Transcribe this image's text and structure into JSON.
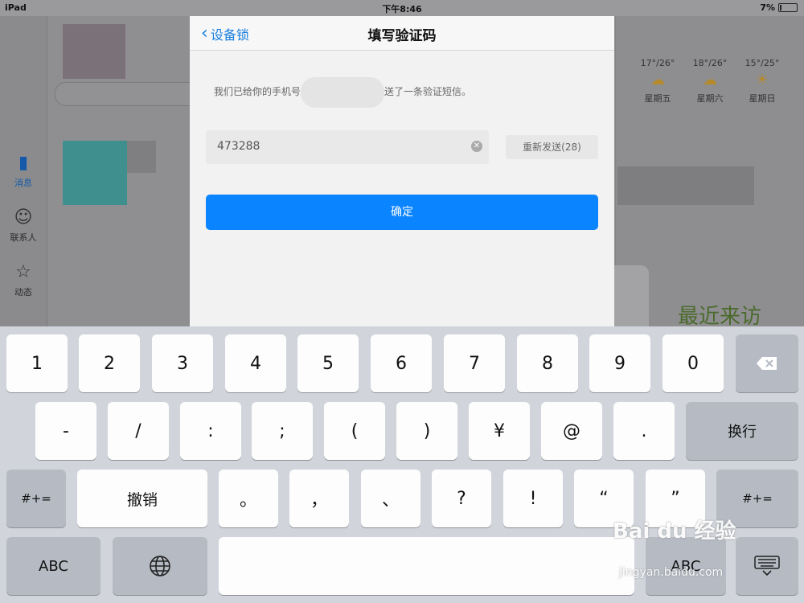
{
  "statusbar": {
    "device": "iPad",
    "time": "下午8:46",
    "battery": "7%"
  },
  "sidebar": {
    "items": [
      {
        "label": "消息",
        "icon": "message-icon"
      },
      {
        "label": "联系人",
        "icon": "contacts-icon"
      },
      {
        "label": "动态",
        "icon": "star-icon"
      }
    ]
  },
  "weather": [
    {
      "temp": "17°/26°",
      "day": "星期五"
    },
    {
      "temp": "18°/26°",
      "day": "星期六"
    },
    {
      "temp": "15°/25°",
      "day": "星期日"
    }
  ],
  "recent_visitors": "最近来访",
  "modal": {
    "back_label": "设备锁",
    "title": "填写验证码",
    "hint_prefix": "我们已给你的手机号",
    "hint_suffix": "送了一条验证短信。",
    "code_value": "473288",
    "resend_label": "重新发送(28)",
    "confirm_label": "确定"
  },
  "keyboard": {
    "row1": [
      "1",
      "2",
      "3",
      "4",
      "5",
      "6",
      "7",
      "8",
      "9",
      "0"
    ],
    "row2": [
      "-",
      "/",
      ":",
      ";",
      "(",
      ")",
      "¥",
      "@",
      "."
    ],
    "return_label": "换行",
    "row3_left": "#+=",
    "undo_label": "撤销",
    "row3": [
      "。",
      "，",
      "、",
      "?",
      "!",
      "“",
      "”"
    ],
    "row3_right": "#+=",
    "abc_left": "ABC",
    "abc_right": "ABC"
  },
  "watermark": {
    "brand": "Bai du 经验",
    "url": "jingyan.baidu.com"
  }
}
